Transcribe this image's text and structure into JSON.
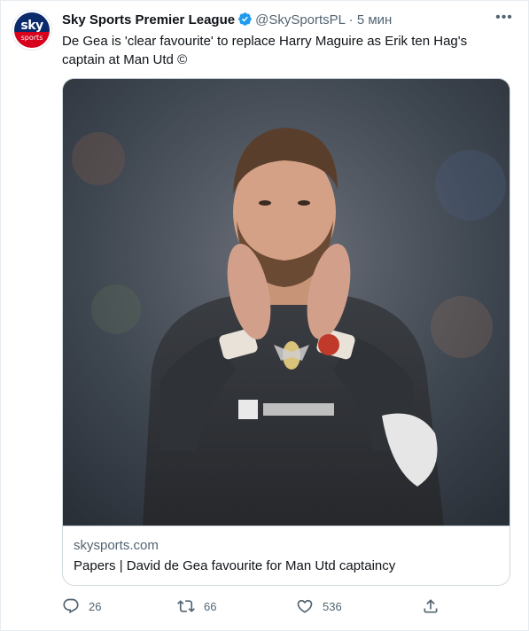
{
  "tweet": {
    "author": {
      "display_name": "Sky Sports Premier League",
      "handle": "@SkySportsPL",
      "verified": true,
      "avatar": {
        "logo_line1": "sky",
        "logo_line2": "sports",
        "icon": "sky-sports-logo"
      }
    },
    "separator": "·",
    "timestamp": "5 мин",
    "text": "De Gea is 'clear favourite' to replace Harry Maguire as Erik ten Hag's captain at Man Utd ©",
    "card": {
      "image_icon": "goalkeeper-applauding-photo",
      "domain": "skysports.com",
      "title": "Papers | David de Gea favourite for Man Utd captaincy"
    },
    "actions": {
      "reply": {
        "icon": "reply-icon",
        "count": "26"
      },
      "retweet": {
        "icon": "retweet-icon",
        "count": "66"
      },
      "like": {
        "icon": "heart-icon",
        "count": "536"
      },
      "share": {
        "icon": "share-icon"
      }
    },
    "more_icon": "more-icon"
  },
  "colors": {
    "verified": "#1d9bf0",
    "secondary_text": "#536471",
    "primary_text": "#0f1419",
    "border": "#cfd9de",
    "sky_blue": "#0b2a6b",
    "sky_red": "#d6001c"
  }
}
